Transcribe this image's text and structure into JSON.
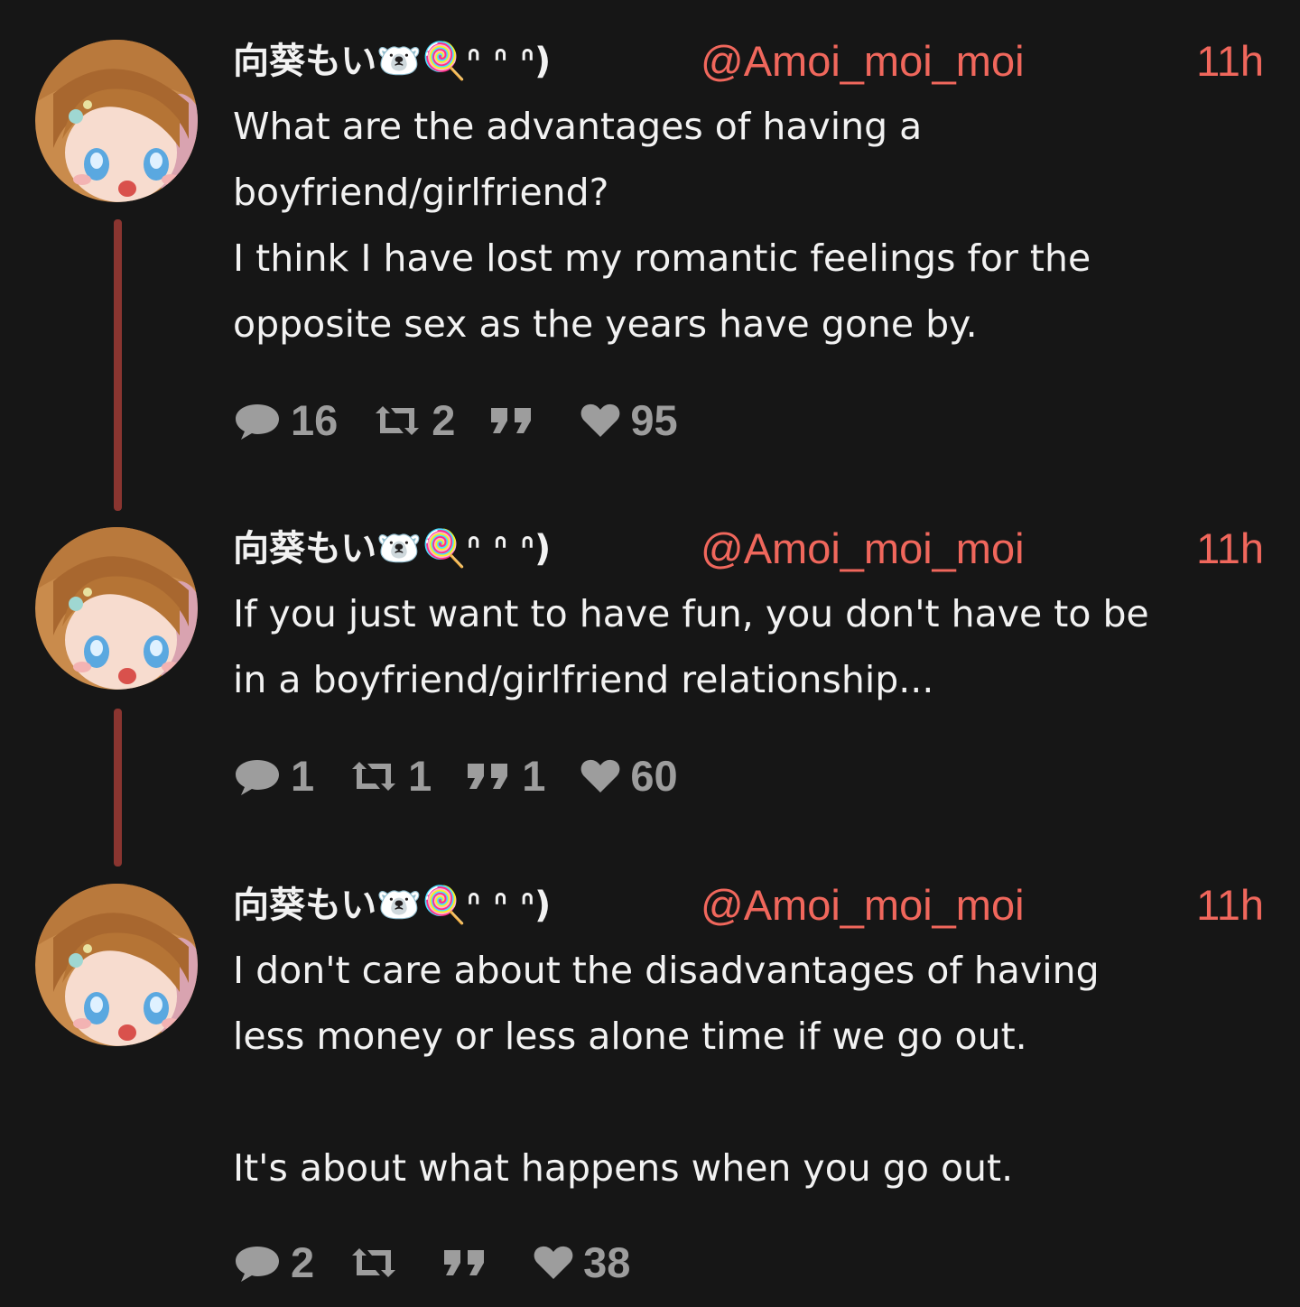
{
  "colors": {
    "background": "#161616",
    "accent": "#f0675c",
    "thread_line": "#8a3530",
    "muted": "#9d9d9d",
    "text": "#f2f2f2"
  },
  "tweets": [
    {
      "display_name": "向葵もい🐻‍❄️🍭ᐢ ᐢ ᐢ)",
      "handle": "@Amoi_moi_moi",
      "time": "11h",
      "text": "What are the advantages of having a\nboyfriend/girlfriend?\nI think I have lost my romantic feelings for the\nopposite sex as the years have gone by.",
      "replies": "16",
      "retweets": "2",
      "quotes": "",
      "likes": "95"
    },
    {
      "display_name": "向葵もい🐻‍❄️🍭ᐢ ᐢ ᐢ)",
      "handle": "@Amoi_moi_moi",
      "time": "11h",
      "text": "If you just want to have fun, you don't have to be\nin a boyfriend/girlfriend relationship...",
      "replies": "1",
      "retweets": "1",
      "quotes": "1",
      "likes": "60"
    },
    {
      "display_name": "向葵もい🐻‍❄️🍭ᐢ ᐢ ᐢ)",
      "handle": "@Amoi_moi_moi",
      "time": "11h",
      "text": "I don't care about the disadvantages of having\nless money or less alone time if we go out.\n\nIt's about what happens when you go out.",
      "replies": "2",
      "retweets": "",
      "quotes": "",
      "likes": "38"
    }
  ],
  "icons": {
    "reply": "speech-bubble-icon",
    "retweet": "retweet-arrows-icon",
    "quote": "quote-marks-icon",
    "like": "heart-icon",
    "avatar": "anime-girl-avatar"
  }
}
